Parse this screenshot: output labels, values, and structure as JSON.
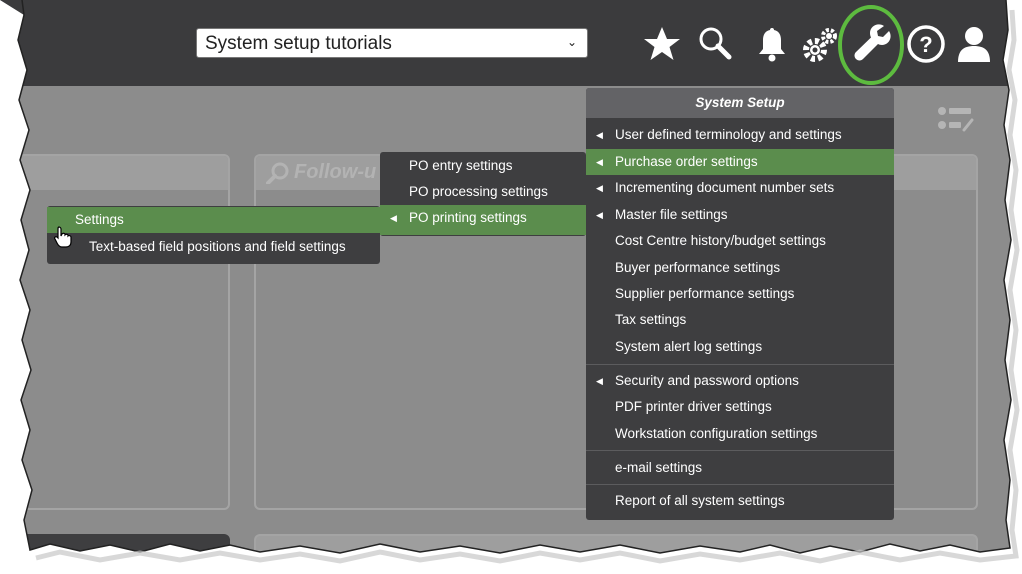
{
  "toolbar": {
    "tutorial_select_value": "System setup tutorials",
    "icons": [
      "star-icon",
      "search-icon",
      "bell-icon",
      "gears-icon",
      "wrench-icon",
      "help-icon",
      "user-icon"
    ],
    "highlight_color": "#5dbb3f"
  },
  "panels": {
    "follow_up_title": "Follow-u"
  },
  "system_setup_menu": {
    "title": "System Setup",
    "items": [
      {
        "label": "User defined terminology and settings",
        "submenu": true
      },
      {
        "label": "Purchase order settings",
        "submenu": true,
        "active": true
      },
      {
        "label": "Incrementing document number sets",
        "submenu": true
      },
      {
        "label": "Master file settings",
        "submenu": true
      },
      {
        "label": "Cost Centre history/budget settings"
      },
      {
        "label": "Buyer performance settings"
      },
      {
        "label": "Supplier performance settings"
      },
      {
        "label": "Tax settings"
      },
      {
        "label": "System alert log settings"
      },
      {
        "label": "Security and password options",
        "submenu": true
      },
      {
        "label": "PDF printer driver settings"
      },
      {
        "label": "Workstation configuration settings"
      },
      {
        "label": "e-mail settings"
      },
      {
        "label": "Report of all system settings"
      }
    ]
  },
  "po_settings_menu": {
    "items": [
      {
        "label": "PO entry settings"
      },
      {
        "label": "PO processing settings"
      },
      {
        "label": "PO printing settings",
        "submenu": true,
        "active": true
      }
    ]
  },
  "po_printing_menu": {
    "items": [
      {
        "label": "Settings",
        "active": true
      },
      {
        "label": "Text-based field positions and field settings"
      }
    ]
  },
  "colors": {
    "topbar": "#3b3b3d",
    "body": "#8c8c8c",
    "menu": "#3e3e40",
    "menu_active": "#5b8d4d"
  }
}
